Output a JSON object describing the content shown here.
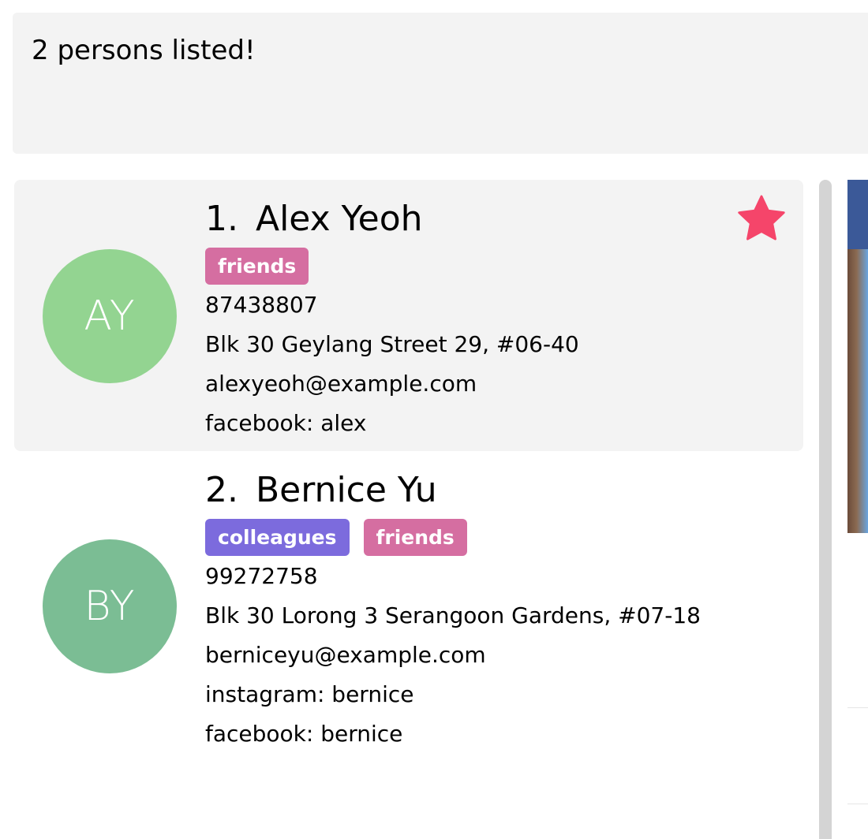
{
  "result": {
    "message": "2 persons listed!"
  },
  "persons": [
    {
      "index": "1.",
      "name": "Alex Yeoh",
      "initials": "AY",
      "avatar_color": "#93d491",
      "selected": true,
      "favorite": true,
      "tags": [
        {
          "label": "friends",
          "color": "#d56ea1"
        }
      ],
      "phone": "87438807",
      "address": "Blk 30 Geylang Street 29, #06-40",
      "email": "alexyeoh@example.com",
      "socials": [
        "facebook: alex"
      ]
    },
    {
      "index": "2.",
      "name": "Bernice Yu",
      "initials": "BY",
      "avatar_color": "#7bbd94",
      "selected": false,
      "favorite": false,
      "tags": [
        {
          "label": "colleagues",
          "color": "#7c6bdd"
        },
        {
          "label": "friends",
          "color": "#d56ea1"
        }
      ],
      "phone": "99272758",
      "address": "Blk 30 Lorong 3 Serangoon Gardens, #07-18",
      "email": "berniceyu@example.com",
      "socials": [
        "instagram: bernice",
        "facebook: bernice"
      ]
    }
  ],
  "star_color": "#f5456a"
}
